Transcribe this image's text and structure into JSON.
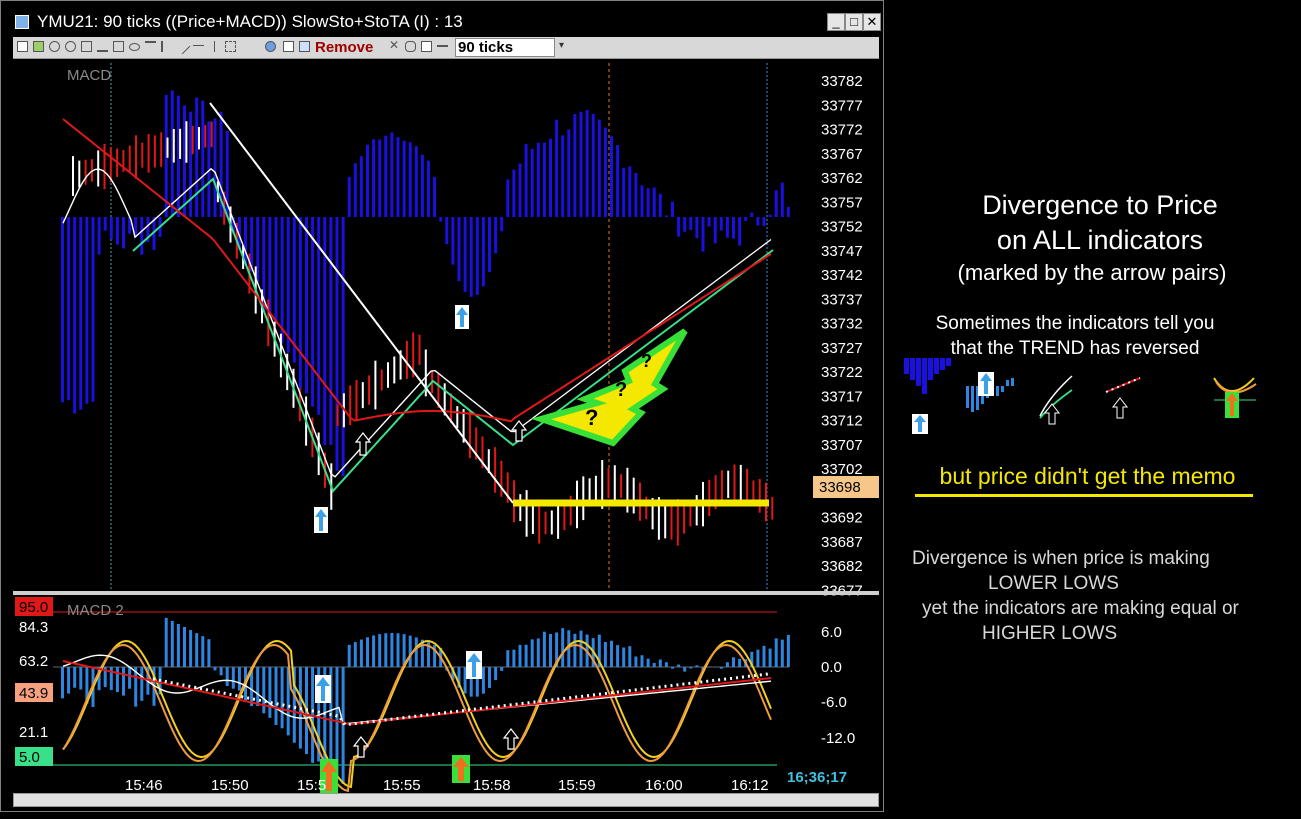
{
  "window": {
    "title": "YMU21: 90 ticks ((Price+MACD)) SlowSto+StoTA (I) : 13",
    "minimize": "_",
    "maximize": "□",
    "close": "✕"
  },
  "toolbar": {
    "remove_label": "Remove",
    "interval_value": "90 ticks",
    "icons": [
      "cursor-icon",
      "bar-chart-icon",
      "zoom-in-icon",
      "zoom-out-icon",
      "crosshair-icon",
      "pencil-icon",
      "rectangle-icon",
      "ellipse-icon",
      "fibonacci-icon",
      "trendline-icon",
      "line-icon",
      "horizontal-line-icon",
      "vertical-line-icon",
      "channel-icon",
      "indicator-icon",
      "properties-icon"
    ]
  },
  "price_panel": {
    "label": "MACD",
    "current_price": "33698",
    "y_labels": [
      "33782",
      "33777",
      "33772",
      "33767",
      "33762",
      "33757",
      "33752",
      "33747",
      "33742",
      "33737",
      "33732",
      "33727",
      "33722",
      "33717",
      "33712",
      "33707",
      "33702",
      "33692",
      "33687",
      "33682",
      "33677"
    ]
  },
  "lower_panel": {
    "label": "MACD 2",
    "left_labels": [
      "95.0",
      "84.3",
      "63.2",
      "43.9",
      "21.1",
      "5.0"
    ],
    "right_labels": [
      "6.0",
      "0.0",
      "-6.0",
      "-12.0"
    ],
    "clock": "16;36;17"
  },
  "time_axis": [
    "15:46",
    "15:50",
    "15:5",
    "15:55",
    "15:58",
    "15:59",
    "16:00",
    "16:12"
  ],
  "annotations": {
    "heading_line1": "Divergence to Price",
    "heading_line2": "on ALL indicators",
    "heading_line3": "(marked by the arrow pairs)",
    "trend_line1": "Sometimes the indicators tell you",
    "trend_line2": "that the TREND has reversed",
    "memo": "but price didn't get the memo",
    "def_line1": "Divergence is when price is making",
    "def_line2": "LOWER LOWS",
    "def_line3": "yet the indicators are making equal or",
    "def_line4": "HIGHER LOWS",
    "question_marks": [
      "?",
      "?",
      "?"
    ]
  },
  "colors": {
    "macd_hist": "#1a10e0",
    "macd_hist_lower": "#2f86e0",
    "ema_fast": "#e01818",
    "stoch_line": "#ffffff",
    "stoch_green": "#38e08a",
    "highlight": "#f4e800",
    "arrow_up": "#3aa0e8",
    "price_tag": "#f7c78a"
  }
}
